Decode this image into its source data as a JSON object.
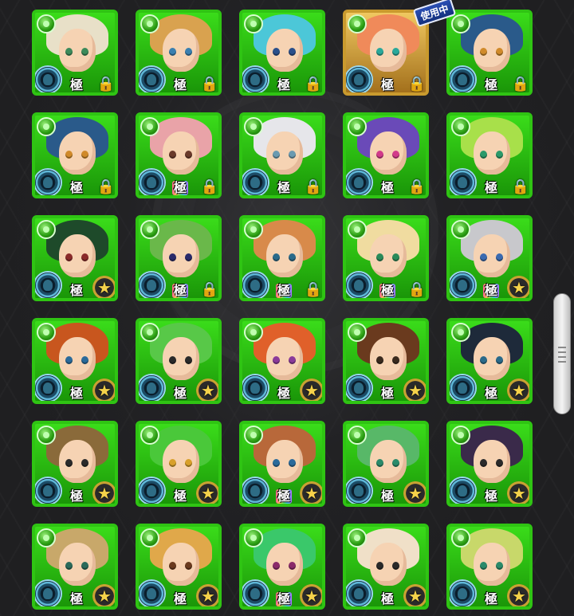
{
  "screen": {
    "in_use_label": "使用中",
    "in_use_slot": 4
  },
  "colors": {
    "frame_green": "#2fc413",
    "frame_gold": "#c99a2e",
    "background": "#1f1f21",
    "star_gold": "#f5d24a"
  },
  "cards": [
    {
      "mark": "極",
      "rainbow": false,
      "status": "lock",
      "frame": "green",
      "hair": "#e8e0c8",
      "eye": "#3c8a5a"
    },
    {
      "mark": "極",
      "rainbow": false,
      "status": "lock",
      "frame": "green",
      "hair": "#d9a24f",
      "eye": "#3a7fb0"
    },
    {
      "mark": "極",
      "rainbow": false,
      "status": "lock",
      "frame": "green",
      "hair": "#4cc7d8",
      "eye": "#2a4f8a"
    },
    {
      "mark": "極",
      "rainbow": false,
      "status": "lock",
      "frame": "gold",
      "hair": "#f08a5a",
      "eye": "#2aa89a"
    },
    {
      "mark": "極",
      "rainbow": false,
      "status": "lock",
      "frame": "green",
      "hair": "#2a5a8a",
      "eye": "#d08a2a"
    },
    {
      "mark": "極",
      "rainbow": false,
      "status": "lock",
      "frame": "green",
      "hair": "#2a5a8a",
      "eye": "#d08a2a"
    },
    {
      "mark": "極",
      "rainbow": true,
      "status": "lock",
      "frame": "green",
      "hair": "#e9a3a8",
      "eye": "#6a3a2a"
    },
    {
      "mark": "極",
      "rainbow": false,
      "status": "lock",
      "frame": "green",
      "hair": "#e6e6ea",
      "eye": "#6a9ab0"
    },
    {
      "mark": "極",
      "rainbow": false,
      "status": "lock",
      "frame": "green",
      "hair": "#6a4ab8",
      "eye": "#d23a8a"
    },
    {
      "mark": "極",
      "rainbow": false,
      "status": "lock",
      "frame": "green",
      "hair": "#a8e04a",
      "eye": "#2a9a6a"
    },
    {
      "mark": "極",
      "rainbow": false,
      "status": "star",
      "frame": "green",
      "hair": "#1e4a2a",
      "eye": "#8a2a2a"
    },
    {
      "mark": "極",
      "rainbow": true,
      "status": "lock",
      "frame": "green",
      "hair": "#6ab84a",
      "eye": "#2a2a6a"
    },
    {
      "mark": "極",
      "rainbow": true,
      "status": "lock",
      "frame": "green",
      "hair": "#d88a4a",
      "eye": "#2a6a8a"
    },
    {
      "mark": "極",
      "rainbow": true,
      "status": "lock",
      "frame": "green",
      "hair": "#f0dca0",
      "eye": "#2a8a5a"
    },
    {
      "mark": "極",
      "rainbow": true,
      "status": "star",
      "frame": "green",
      "hair": "#c8c8cc",
      "eye": "#3a6ab0"
    },
    {
      "mark": "極",
      "rainbow": false,
      "status": "star",
      "frame": "green",
      "hair": "#c8561e",
      "eye": "#2a6a9a"
    },
    {
      "mark": "極",
      "rainbow": false,
      "status": "star",
      "frame": "green",
      "hair": "#58c848",
      "eye": "#2a2a2a"
    },
    {
      "mark": "極",
      "rainbow": false,
      "status": "star",
      "frame": "green",
      "hair": "#e0602a",
      "eye": "#8a3a9a"
    },
    {
      "mark": "極",
      "rainbow": false,
      "status": "star",
      "frame": "green",
      "hair": "#6a3a1e",
      "eye": "#3a2a1e"
    },
    {
      "mark": "極",
      "rainbow": false,
      "status": "star",
      "frame": "green",
      "hair": "#1e2a3a",
      "eye": "#2a6a8a"
    },
    {
      "mark": "極",
      "rainbow": false,
      "status": "star",
      "frame": "green",
      "hair": "#8a6a3a",
      "eye": "#2a2a2a"
    },
    {
      "mark": "極",
      "rainbow": false,
      "status": "star",
      "frame": "green",
      "hair": "#4ac83a",
      "eye": "#d8a02a"
    },
    {
      "mark": "極",
      "rainbow": true,
      "status": "star",
      "frame": "green",
      "hair": "#b8683a",
      "eye": "#2a6a9a"
    },
    {
      "mark": "極",
      "rainbow": false,
      "status": "star",
      "frame": "green",
      "hair": "#58b868",
      "eye": "#2a8a6a"
    },
    {
      "mark": "極",
      "rainbow": false,
      "status": "star",
      "frame": "green",
      "hair": "#3a2a4a",
      "eye": "#2a2a2a"
    },
    {
      "mark": "極",
      "rainbow": false,
      "status": "star",
      "frame": "green",
      "hair": "#c8a86a",
      "eye": "#2a6a5a"
    },
    {
      "mark": "極",
      "rainbow": false,
      "status": "star",
      "frame": "green",
      "hair": "#e0a84a",
      "eye": "#6a3a1e"
    },
    {
      "mark": "極",
      "rainbow": true,
      "status": "star",
      "frame": "green",
      "hair": "#3ac86a",
      "eye": "#8a2a6a"
    },
    {
      "mark": "極",
      "rainbow": false,
      "status": "star",
      "frame": "green",
      "hair": "#f0e0c8",
      "eye": "#2a2a2a"
    },
    {
      "mark": "極",
      "rainbow": false,
      "status": "star",
      "frame": "green",
      "hair": "#c8d86a",
      "eye": "#2a8a6a"
    }
  ],
  "icons": {
    "lock": "🔒",
    "star": "★"
  }
}
